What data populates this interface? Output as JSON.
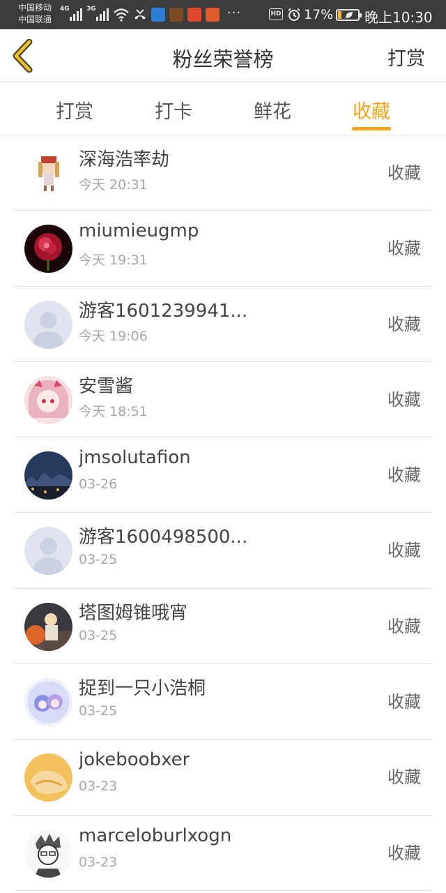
{
  "status_bar": {
    "carrier_1": "中国移动",
    "carrier_2": "中国联通",
    "net_1": "4G",
    "net_2": "3G",
    "battery_pct": "17%",
    "battery_level": 0.17,
    "time": "晚上10:30",
    "more": "···",
    "hd": "HD",
    "icons": [
      "wifi-icon",
      "missed-call-icon",
      "alarm-icon",
      "battery-icon"
    ]
  },
  "header": {
    "title": "粉丝荣誉榜",
    "right_label": "打赏",
    "back_icon": "chevron-left-icon"
  },
  "tabs": [
    {
      "label": "打赏",
      "active": false
    },
    {
      "label": "打卡",
      "active": false
    },
    {
      "label": "鲜花",
      "active": false
    },
    {
      "label": "收藏",
      "active": true
    }
  ],
  "accent_color": "#f1a51d",
  "fans": [
    {
      "name": "深海浩率劫",
      "time": "今天 20:31",
      "action": "收藏",
      "avatar": "pixel-girl"
    },
    {
      "name": "miumieugmp",
      "time": "今天 19:31",
      "action": "收藏",
      "avatar": "rose"
    },
    {
      "name": "游客1601239941...",
      "time": "今天 19:06",
      "action": "收藏",
      "avatar": "default"
    },
    {
      "name": "安雪酱",
      "time": "今天 18:51",
      "action": "收藏",
      "avatar": "anime-pink"
    },
    {
      "name": "jmsolutafion",
      "time": "03-26",
      "action": "收藏",
      "avatar": "night-city"
    },
    {
      "name": "游客1600498500...",
      "time": "03-25",
      "action": "收藏",
      "avatar": "default"
    },
    {
      "name": "塔图姆锥哦宵",
      "time": "03-25",
      "action": "收藏",
      "avatar": "dark-figure"
    },
    {
      "name": "捉到一只小浩桐",
      "time": "03-25",
      "action": "收藏",
      "avatar": "anime-blue"
    },
    {
      "name": "jokeboobxer",
      "time": "03-23",
      "action": "收藏",
      "avatar": "orange"
    },
    {
      "name": "marceloburlxogn",
      "time": "03-23",
      "action": "收藏",
      "avatar": "sketch"
    }
  ]
}
